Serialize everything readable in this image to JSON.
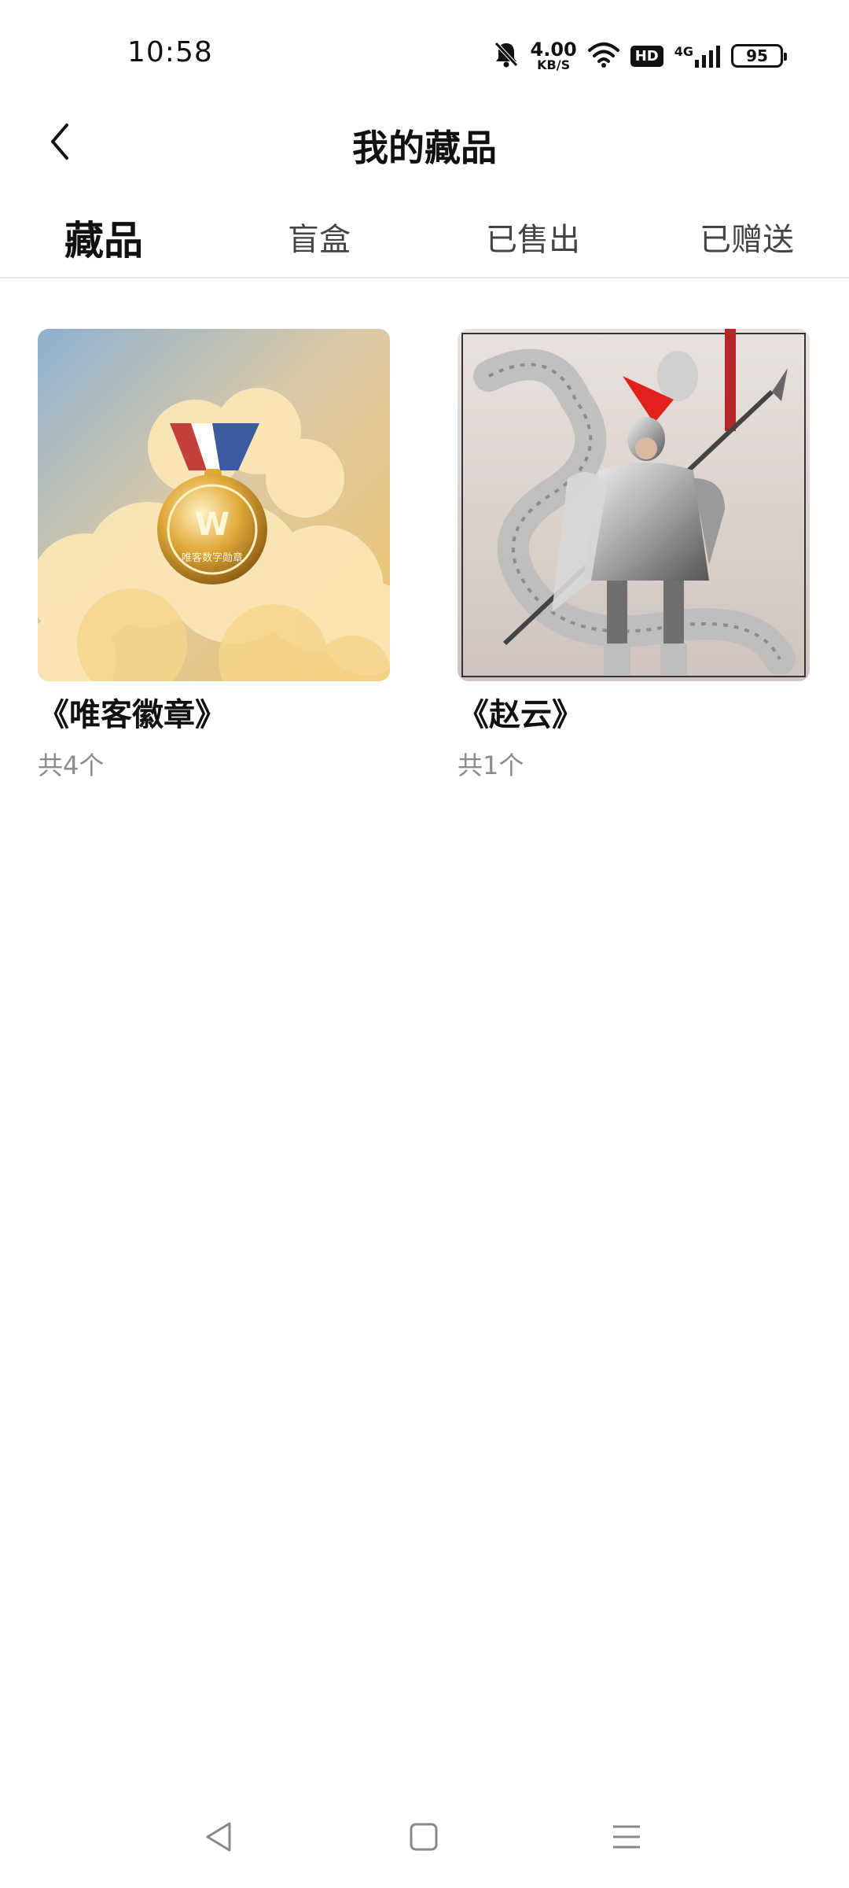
{
  "status_bar": {
    "time": "10:58",
    "net_speed_value": "4.00",
    "net_speed_unit": "KB/S",
    "hd_label": "HD",
    "network_label": "4G",
    "battery_level": "95",
    "icons": [
      "bell-off-icon",
      "wifi-icon",
      "signal-icon",
      "battery-icon"
    ]
  },
  "header": {
    "title": "我的藏品",
    "back_icon": "chevron-left-icon"
  },
  "tabs": [
    {
      "label": "藏品",
      "active": true
    },
    {
      "label": "盲盒",
      "active": false
    },
    {
      "label": "已售出",
      "active": false
    },
    {
      "label": "已赠送",
      "active": false
    }
  ],
  "collection": [
    {
      "name": "《唯客徽章》",
      "count": "共4个",
      "medal_text": "唯客数字勋章",
      "medal_letter": "W"
    },
    {
      "name": "《赵云》",
      "count": "共1个"
    }
  ],
  "bottom_nav": {
    "icons": [
      "back-triangle-icon",
      "home-square-icon",
      "menu-lines-icon"
    ]
  },
  "colors": {
    "accent": "#111111",
    "secondary_text": "#8c8c8c",
    "divider": "#e6e6e6"
  }
}
